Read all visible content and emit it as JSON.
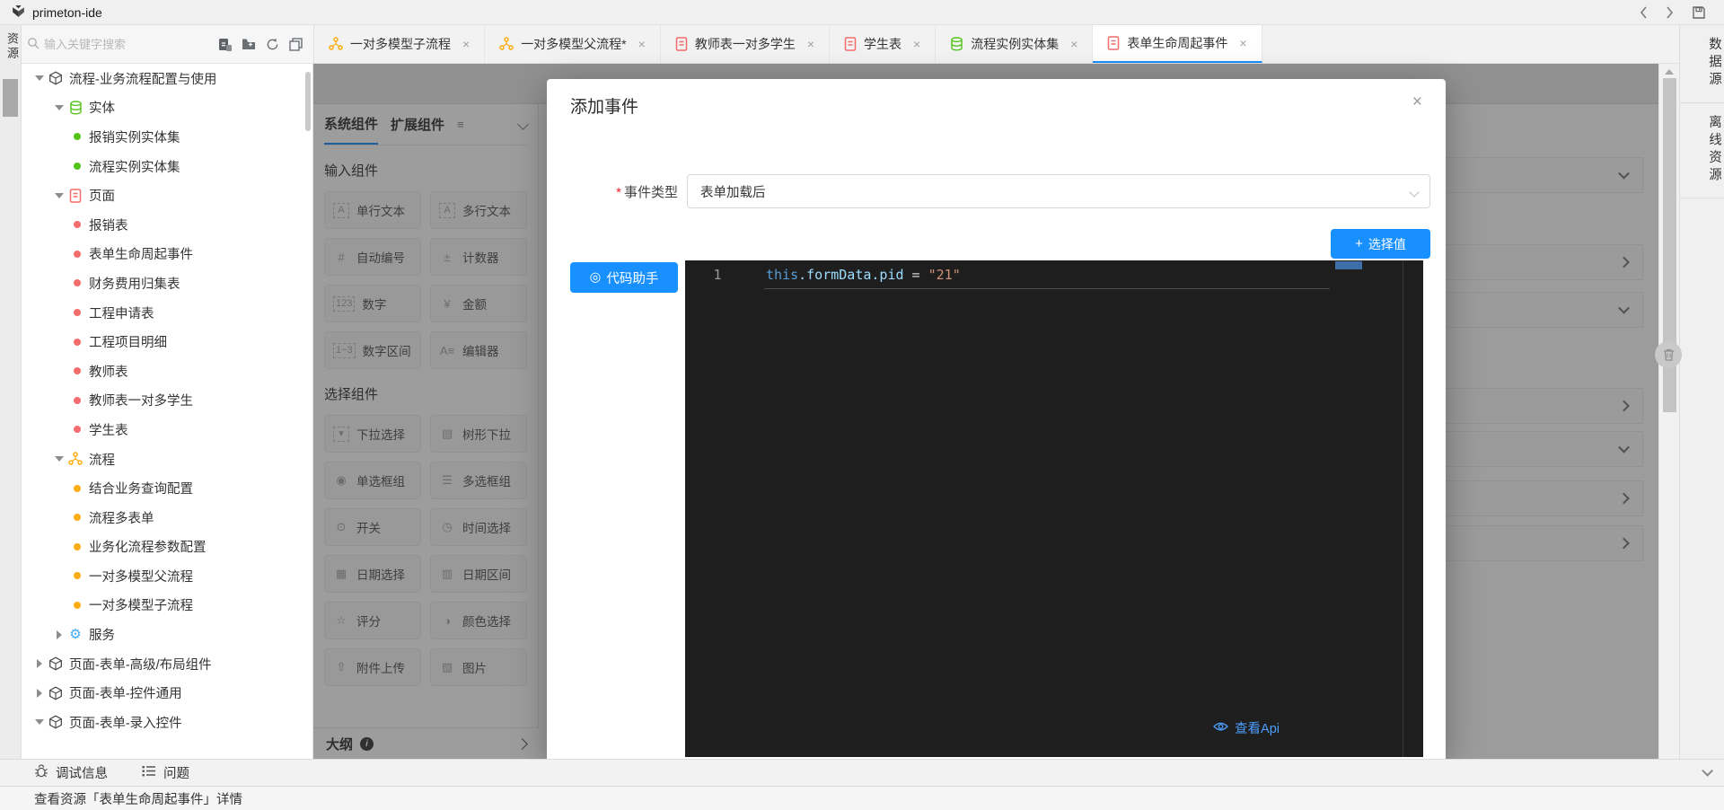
{
  "app": {
    "title": "primeton-ide"
  },
  "left_strip": {
    "tab": "资源"
  },
  "right_strip": {
    "tabs": [
      "数据源",
      "离线资源"
    ]
  },
  "toolbar": {
    "search_placeholder": "输入关键字搜索"
  },
  "editor_tabs": [
    {
      "label": "一对多模型子流程",
      "type": "flow",
      "icon": "flow-icon",
      "active": false
    },
    {
      "label": "一对多模型父流程*",
      "type": "flow",
      "icon": "flow-icon",
      "active": false
    },
    {
      "label": "教师表一对多学生",
      "type": "page",
      "icon": "page-icon",
      "active": false
    },
    {
      "label": "学生表",
      "type": "page",
      "icon": "page-icon",
      "active": false
    },
    {
      "label": "流程实例实体集",
      "type": "entity",
      "icon": "entity-icon",
      "active": false
    },
    {
      "label": "表单生命周起事件",
      "type": "page",
      "icon": "page-icon",
      "active": true
    }
  ],
  "tree": {
    "items": [
      {
        "label": "流程-业务流程配置与使用",
        "depth": 0,
        "type": "package",
        "state": "open"
      },
      {
        "label": "实体",
        "depth": 1,
        "type": "entity",
        "state": "open"
      },
      {
        "label": "报销实例实体集",
        "depth": 2,
        "dot": "#52c41a"
      },
      {
        "label": "流程实例实体集",
        "depth": 2,
        "dot": "#52c41a"
      },
      {
        "label": "页面",
        "depth": 1,
        "type": "page",
        "state": "open"
      },
      {
        "label": "报销表",
        "depth": 2,
        "dot": "#f56c6c"
      },
      {
        "label": "表单生命周起事件",
        "depth": 2,
        "dot": "#f56c6c"
      },
      {
        "label": "财务费用归集表",
        "depth": 2,
        "dot": "#f56c6c"
      },
      {
        "label": "工程申请表",
        "depth": 2,
        "dot": "#f56c6c"
      },
      {
        "label": "工程项目明细",
        "depth": 2,
        "dot": "#f56c6c"
      },
      {
        "label": "教师表",
        "depth": 2,
        "dot": "#f56c6c"
      },
      {
        "label": "教师表一对多学生",
        "depth": 2,
        "dot": "#f56c6c"
      },
      {
        "label": "学生表",
        "depth": 2,
        "dot": "#f56c6c"
      },
      {
        "label": "流程",
        "depth": 1,
        "type": "flow",
        "state": "open"
      },
      {
        "label": "结合业务查询配置",
        "depth": 2,
        "dot": "#faad14"
      },
      {
        "label": "流程多表单",
        "depth": 2,
        "dot": "#faad14"
      },
      {
        "label": "业务化流程参数配置",
        "depth": 2,
        "dot": "#faad14"
      },
      {
        "label": "一对多模型父流程",
        "depth": 2,
        "dot": "#faad14"
      },
      {
        "label": "一对多模型子流程",
        "depth": 2,
        "dot": "#faad14"
      },
      {
        "label": "服务",
        "depth": 1,
        "type": "service",
        "state": "closed"
      },
      {
        "label": "页面-表单-高级/布局组件",
        "depth": 0,
        "type": "package",
        "state": "closed"
      },
      {
        "label": "页面-表单-控件通用",
        "depth": 0,
        "type": "package",
        "state": "closed"
      },
      {
        "label": "页面-表单-录入控件",
        "depth": 0,
        "type": "package",
        "state": "open"
      }
    ]
  },
  "palette": {
    "tabs": [
      {
        "label": "系统组件",
        "active": true
      },
      {
        "label": "扩展组件",
        "active": false
      }
    ],
    "sections": [
      {
        "title": "输入组件",
        "items": [
          {
            "label": "单行文本",
            "glyph": "A",
            "boxed": true,
            "icon": "single-line-text-icon"
          },
          {
            "label": "多行文本",
            "glyph": "A",
            "boxed": true,
            "icon": "multi-line-text-icon"
          },
          {
            "label": "自动编号",
            "glyph": "#",
            "boxed": false,
            "icon": "auto-number-icon"
          },
          {
            "label": "计数器",
            "glyph": "±",
            "boxed": false,
            "icon": "counter-icon"
          },
          {
            "label": "数字",
            "glyph": "123",
            "boxed": true,
            "icon": "number-icon"
          },
          {
            "label": "金额",
            "glyph": "¥",
            "boxed": false,
            "icon": "currency-icon"
          },
          {
            "label": "数字区间",
            "glyph": "1~3",
            "boxed": true,
            "icon": "number-range-icon"
          },
          {
            "label": "编辑器",
            "glyph": "A≡",
            "boxed": false,
            "icon": "editor-icon"
          }
        ]
      },
      {
        "title": "选择组件",
        "items": [
          {
            "label": "下拉选择",
            "glyph": "▾",
            "boxed": true,
            "icon": "dropdown-icon"
          },
          {
            "label": "树形下拉",
            "glyph": "▤",
            "boxed": false,
            "icon": "tree-dropdown-icon"
          },
          {
            "label": "单选框组",
            "glyph": "◉",
            "boxed": false,
            "icon": "radio-group-icon"
          },
          {
            "label": "多选框组",
            "glyph": "☰",
            "boxed": false,
            "icon": "checkbox-group-icon"
          },
          {
            "label": "开关",
            "glyph": "⊙",
            "boxed": false,
            "icon": "switch-icon"
          },
          {
            "label": "时间选择",
            "glyph": "◷",
            "boxed": false,
            "icon": "time-picker-icon"
          },
          {
            "label": "日期选择",
            "glyph": "▦",
            "boxed": false,
            "icon": "date-picker-icon"
          },
          {
            "label": "日期区间",
            "glyph": "▥",
            "boxed": false,
            "icon": "date-range-icon"
          },
          {
            "label": "评分",
            "glyph": "☆",
            "boxed": false,
            "icon": "rating-icon"
          },
          {
            "label": "颜色选择",
            "glyph": "◑",
            "boxed": false,
            "icon": "color-picker-icon"
          },
          {
            "label": "附件上传",
            "glyph": "⇧",
            "boxed": false,
            "icon": "upload-icon"
          },
          {
            "label": "图片",
            "glyph": "▧",
            "boxed": false,
            "icon": "image-icon"
          }
        ]
      }
    ],
    "outline": {
      "label": "大纲"
    }
  },
  "modal": {
    "title": "添加事件",
    "close_glyph": "×",
    "event_type": {
      "label": "事件类型",
      "required_mark": "*",
      "value": "表单加载后"
    },
    "buttons": {
      "select_value": "选择值",
      "code_assist": "代码助手"
    },
    "editor": {
      "line_number": "1",
      "code": "this.formData.pid = \"21\"",
      "tokens": [
        {
          "text": "this",
          "color": "#569cd6"
        },
        {
          "text": ".formData.pid",
          "color": "#9cdcfe"
        },
        {
          "text": " = ",
          "color": "#d4d4d4"
        },
        {
          "text": "\"21\"",
          "color": "#ce9178"
        }
      ]
    },
    "view_api": "查看Api"
  },
  "bottom_bar": {
    "debug": "调试信息",
    "problems": "问题"
  },
  "status_bar": {
    "text": "查看资源「表单生命周起事件」详情"
  },
  "colors": {
    "accent": "#1890ff",
    "flow": "#faad14",
    "page": "#f56c6c",
    "entity": "#52c41a",
    "service": "#40a9f3"
  }
}
